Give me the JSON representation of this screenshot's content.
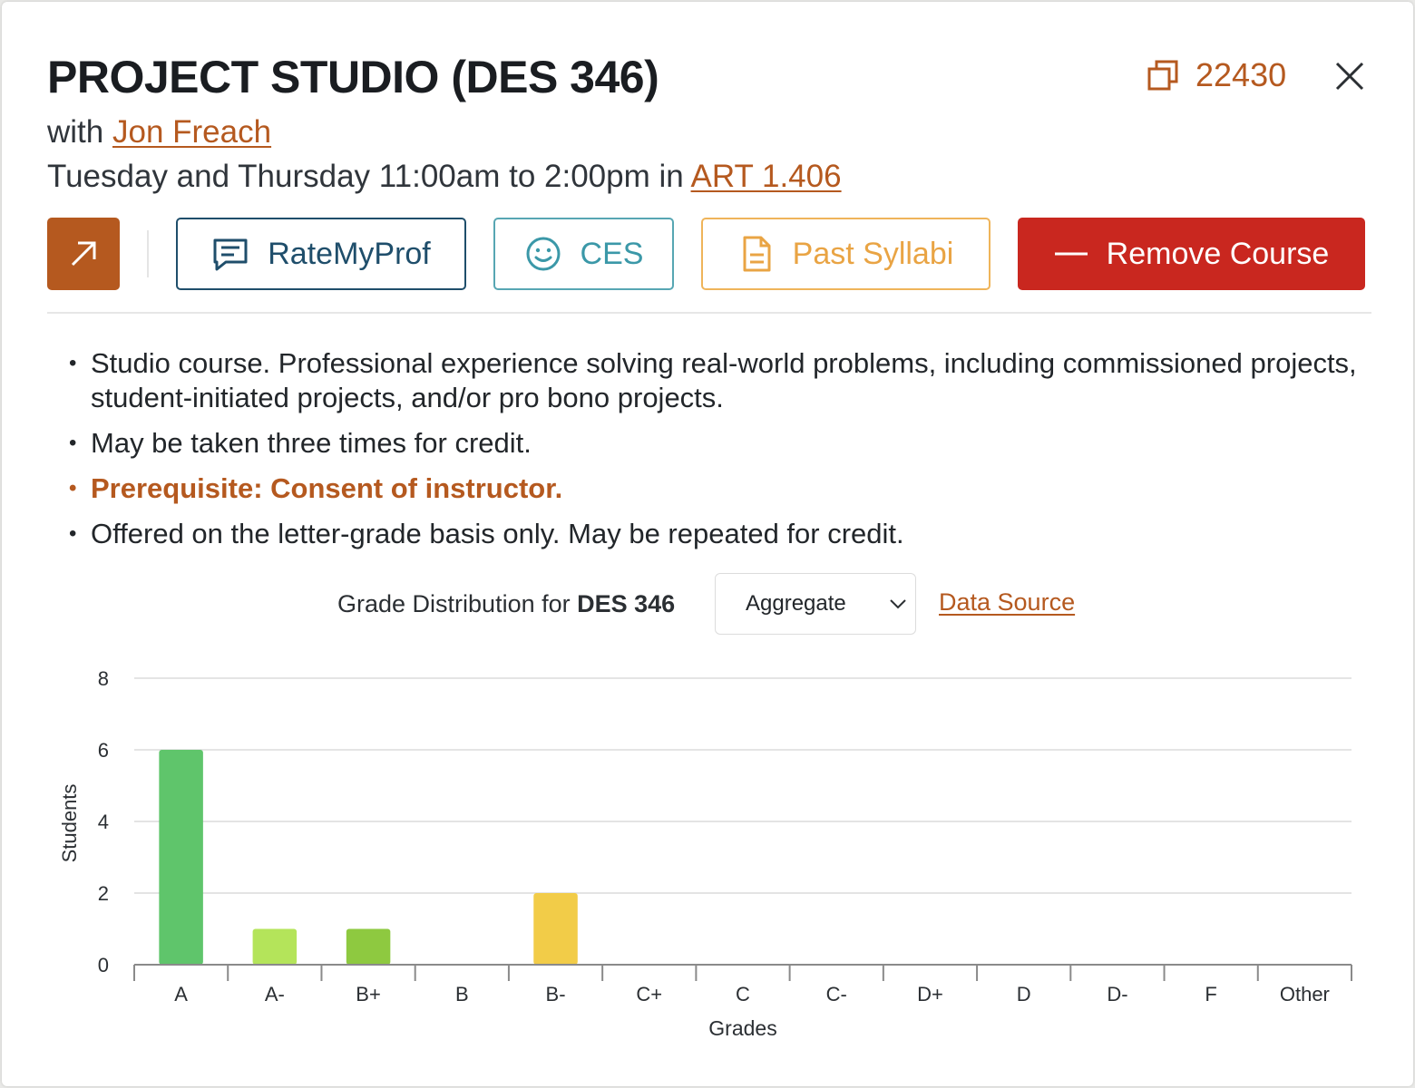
{
  "course": {
    "title": "PROJECT STUDIO (DES 346)",
    "with_prefix": "with",
    "instructor": "Jon Freach",
    "schedule_prefix": "Tuesday and Thursday 11:00am to 2:00pm in",
    "room": "ART 1.406",
    "unique_number": "22430"
  },
  "buttons": {
    "rate_my_prof": "RateMyProf",
    "ces": "CES",
    "past_syllabi": "Past Syllabi",
    "remove_course": "Remove Course"
  },
  "description": [
    "Studio course. Professional experience solving real-world problems, including commissioned projects, student-initiated projects, and/or pro bono projects.",
    "May be taken three times for credit.",
    "Prerequisite: Consent of instructor.",
    "Offered on the letter-grade basis only. May be repeated for credit."
  ],
  "grades": {
    "title_prefix": "Grade Distribution for",
    "course_code": "DES 346",
    "selected_option": "Aggregate",
    "data_source_label": "Data Source"
  },
  "colors": {
    "accent": "#b5591f",
    "remove": "#c9271f",
    "rmp": "#1f4e6b",
    "ces": "#3b98a8",
    "syllabi": "#e9a444"
  },
  "chart_data": {
    "type": "bar",
    "categories": [
      "A",
      "A-",
      "B+",
      "B",
      "B-",
      "C+",
      "C",
      "C-",
      "D+",
      "D",
      "D-",
      "F",
      "Other"
    ],
    "values": [
      6,
      1,
      1,
      0,
      2,
      0,
      0,
      0,
      0,
      0,
      0,
      0,
      0
    ],
    "bar_colors": [
      "#5fc56b",
      "#b4e45a",
      "#8ec940",
      "#c8cf3a",
      "#f2cc48",
      "#f5ac3d",
      "#ee8a3c",
      "#e86a3c",
      "#e04e3c",
      "#d43a3a",
      "#c42e3a",
      "#b02238",
      "#999999"
    ],
    "xlabel": "Grades",
    "ylabel": "Students",
    "ylim": [
      0,
      8
    ],
    "yticks": [
      0,
      2,
      4,
      6,
      8
    ],
    "grid": true
  }
}
